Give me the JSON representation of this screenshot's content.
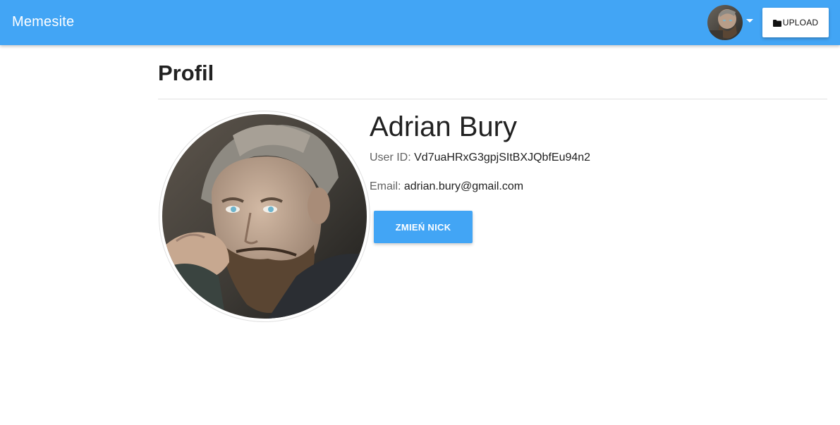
{
  "navbar": {
    "brand": "Memesite",
    "avatar_icon": "user-avatar",
    "caret_icon": "caret-down-icon",
    "upload_label": "UPLOAD",
    "upload_icon": "folder-icon",
    "bar_color": "#42a5f5"
  },
  "profile": {
    "title": "Profil",
    "name": "Adrian Bury",
    "user_id_label": "User ID:",
    "user_id": "Vd7uaHRxG3gpjSItBXJQbfEu94n2",
    "email_label": "Email:",
    "email": "adrian.bury@gmail.com",
    "change_nick_label": "ZMIEŃ NICK",
    "button_color": "#42a5f5"
  }
}
